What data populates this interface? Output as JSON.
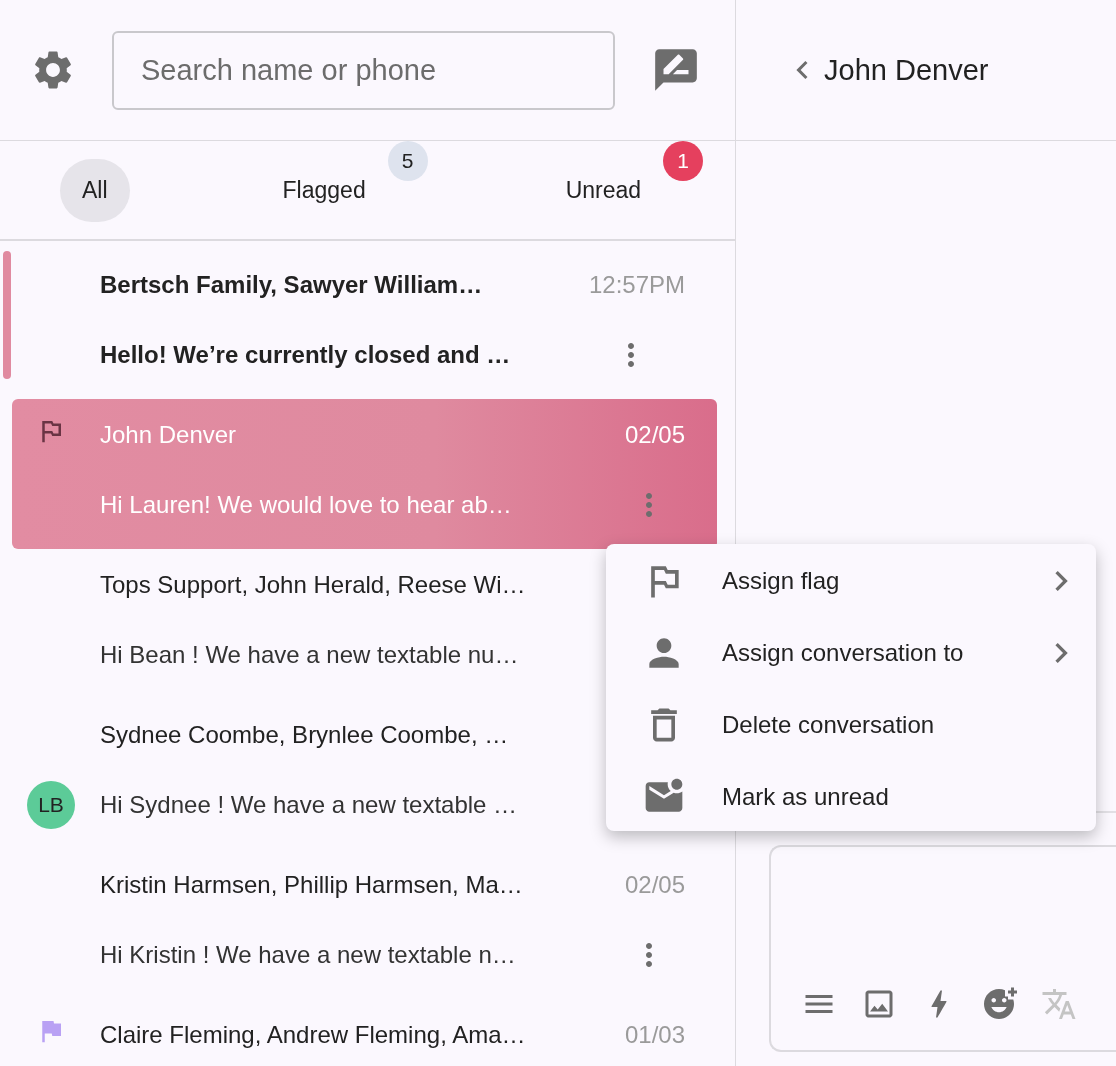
{
  "sidebar": {
    "search": {
      "placeholder": "Search name or phone"
    },
    "tabs": [
      {
        "label": "All",
        "selected": true
      },
      {
        "label": "Flagged",
        "selected": false,
        "badge": "5",
        "alert": false
      },
      {
        "label": "Unread",
        "selected": false,
        "badge": "1",
        "alert": true
      }
    ],
    "conversations": [
      {
        "name": "Bertsch Family, Sawyer William…",
        "time": "12:57PM",
        "preview": "Hello! We’re currently closed and …",
        "unread": true,
        "selected": false
      },
      {
        "name": "John Denver",
        "time": "02/05",
        "preview": "Hi Lauren! We would love to hear ab…",
        "unread": false,
        "selected": true,
        "flagged": true,
        "flag_filled": false
      },
      {
        "name": "Tops Support, John Herald, Reese Wi…",
        "preview": "Hi Bean ! We have a new textable nu…",
        "unread": false,
        "selected": false
      },
      {
        "name": "Sydnee Coombe, Brynlee Coombe, …",
        "preview": "Hi Sydnee ! We have a new textable …",
        "unread": false,
        "selected": false,
        "avatar": {
          "initials": "LB",
          "color": "#5ccb98"
        }
      },
      {
        "name": "Kristin Harmsen, Phillip Harmsen, Ma…",
        "time": "02/05",
        "preview": "Hi Kristin ! We have a new textable n…",
        "unread": false,
        "selected": false
      },
      {
        "name": "Claire Fleming, Andrew Fleming, Ama…",
        "time": "01/03",
        "unread": false,
        "selected": false,
        "flagged": true,
        "flag_filled": true
      }
    ]
  },
  "conversation": {
    "title": "John Denver",
    "composer": {
      "tools": [
        {
          "disabled": false
        },
        {
          "disabled": false
        },
        {
          "disabled": false
        },
        {
          "disabled": false
        },
        {
          "disabled": true
        }
      ]
    }
  },
  "context_menu": {
    "items": [
      {
        "label": "Assign flag",
        "submenu": true
      },
      {
        "label": "Assign conversation to",
        "submenu": true
      },
      {
        "label": "Delete conversation",
        "submenu": false
      },
      {
        "label": "Mark as unread",
        "submenu": false
      }
    ]
  }
}
